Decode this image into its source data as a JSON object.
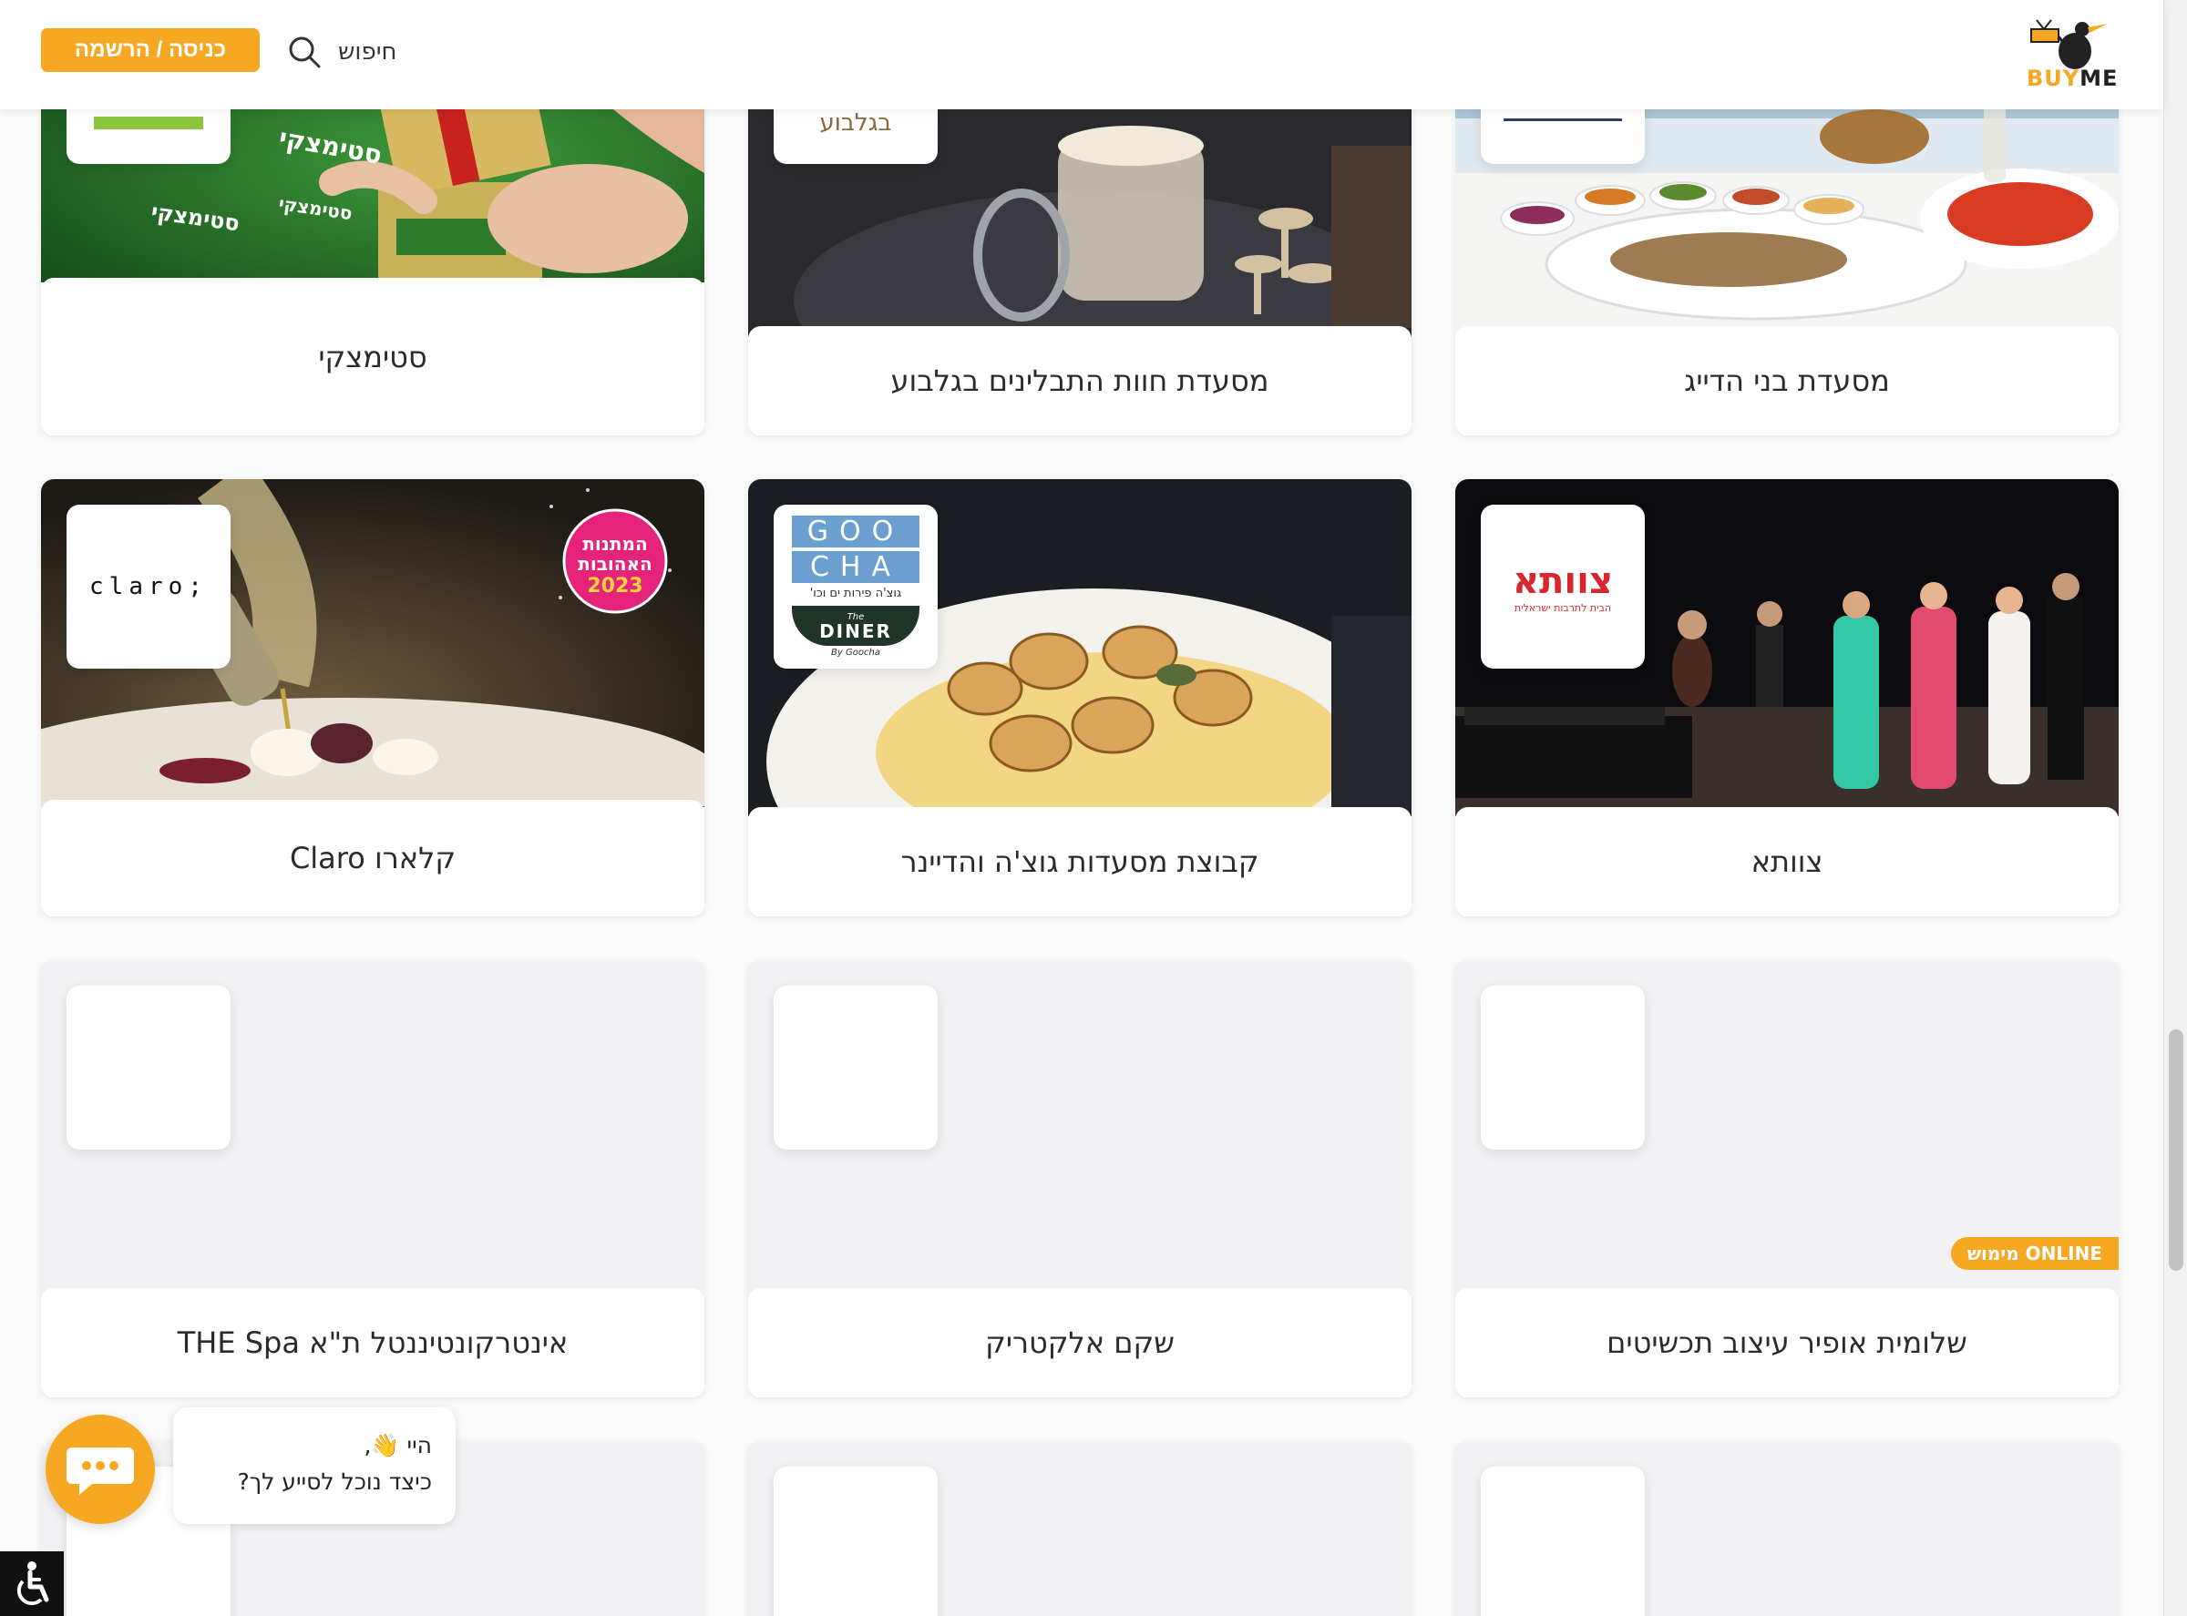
{
  "header": {
    "login_label": "כניסה / הרשמה",
    "search_label": "חיפוש",
    "logo_buy": "BUY",
    "logo_me": "ME"
  },
  "cards": [
    {
      "title": "סטימצקי",
      "logo_text": ""
    },
    {
      "title": "מסעדת חוות התבלינים בגלבוע",
      "logo_text": "בגלבוע"
    },
    {
      "title": "מסעדת בני הדייג",
      "logo_text": ""
    },
    {
      "title": "קלארו Claro",
      "logo_text": "claro;",
      "badge_line1": "המתנות",
      "badge_line2": "האהובות",
      "badge_year": "2023"
    },
    {
      "title": "קבוצת מסעדות גוצ'ה והדיינר",
      "logo_goo": "GOO",
      "logo_cha": "CHA",
      "logo_sub": "גוצ'ה פירות ים וכו'",
      "logo_the": "The",
      "logo_diner": "DINER",
      "logo_by": "By Goocha"
    },
    {
      "title": "צוותא",
      "logo_text": "צוותא",
      "logo_sub": "הבית לתרבות ישראלית"
    },
    {
      "title": "אינטרקונטיננטל ת\"א THE Spa"
    },
    {
      "title": "שקם אלקטריק"
    },
    {
      "title": "שלומית אופיר עיצוב תכשיטים",
      "badge": "מימוש ONLINE"
    }
  ],
  "chat": {
    "line1": "היי 👋,",
    "line2": "כיצד נוכל לסייע לך?"
  },
  "colors": {
    "accent": "#f7a823",
    "placeholder": "#f2f2f4"
  }
}
